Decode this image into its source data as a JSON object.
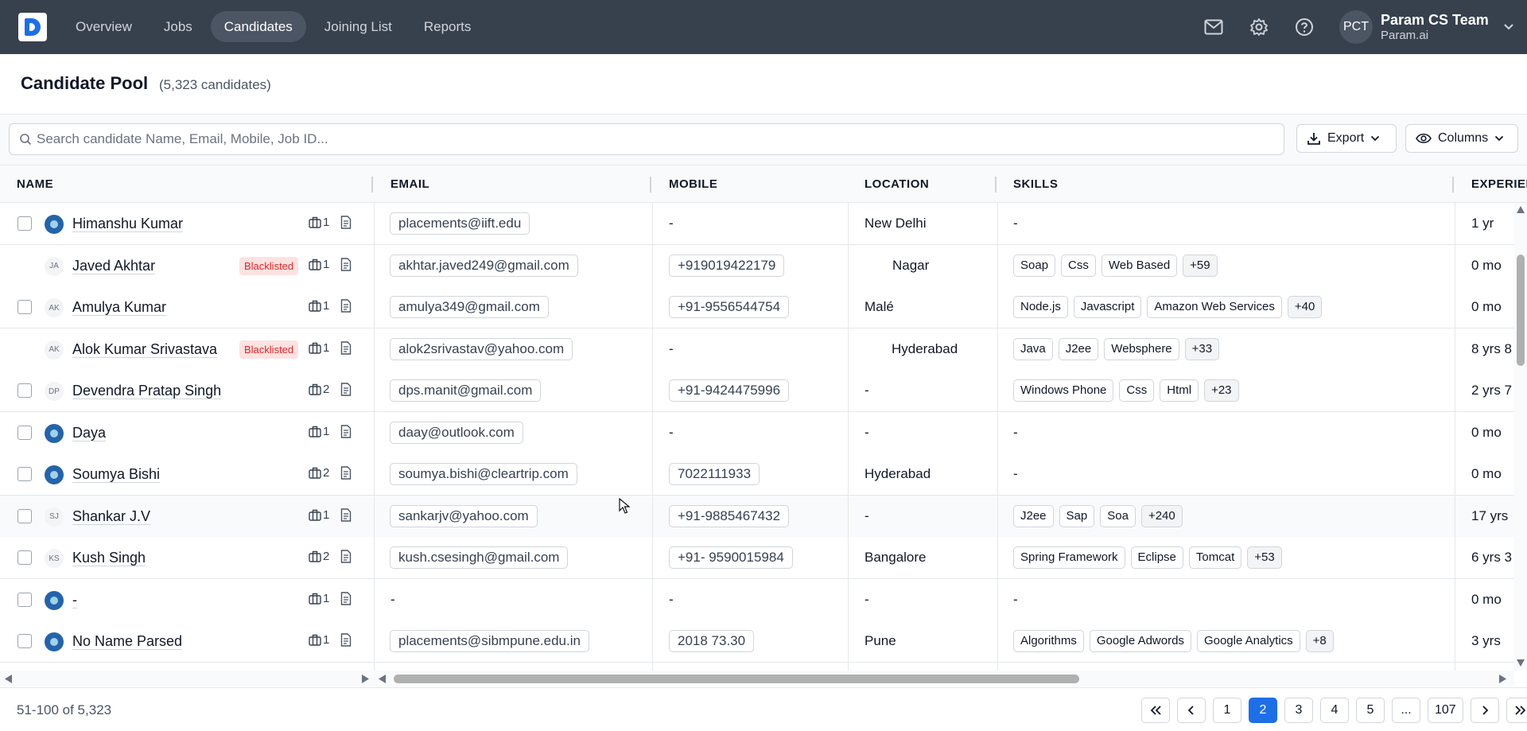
{
  "nav": {
    "links": [
      "Overview",
      "Jobs",
      "Candidates",
      "Joining List",
      "Reports"
    ],
    "active_index": 2,
    "user": {
      "initials": "PCT",
      "name": "Param CS Team",
      "org": "Param.ai"
    }
  },
  "page": {
    "title": "Candidate Pool",
    "count": "(5,323 candidates)"
  },
  "toolbar": {
    "search_placeholder": "Search candidate Name, Email, Mobile, Job ID...",
    "export_label": "Export",
    "columns_label": "Columns"
  },
  "table": {
    "headers": [
      "NAME",
      "EMAIL",
      "MOBILE",
      "LOCATION",
      "SKILLS",
      "EXPERIEN"
    ],
    "rows": [
      {
        "name": "Himanshu Kumar",
        "avatar": "photo",
        "initials": "",
        "blacklisted": false,
        "jobs": "1",
        "email": "placements@iift.edu",
        "mobile": "-",
        "location": "New Delhi",
        "skills": [],
        "experience": "1 yr"
      },
      {
        "name": "Javed Akhtar",
        "avatar": "initials",
        "initials": "JA",
        "blacklisted": true,
        "jobs": "1",
        "email": "akhtar.javed249@gmail.com",
        "mobile": "+919019422179",
        "location": "Nagar",
        "skills": [
          "Soap",
          "Css",
          "Web Based",
          "+59"
        ],
        "experience": "0 mo"
      },
      {
        "name": "Amulya Kumar",
        "avatar": "initials",
        "initials": "AK",
        "blacklisted": false,
        "jobs": "1",
        "email": "amulya349@gmail.com",
        "mobile": "+91-9556544754",
        "location": "Malé",
        "skills": [
          "Node.js",
          "Javascript",
          "Amazon Web Services",
          "+40"
        ],
        "experience": "0 mo"
      },
      {
        "name": "Alok Kumar Srivastava",
        "avatar": "initials",
        "initials": "AK",
        "blacklisted": true,
        "jobs": "1",
        "email": "alok2srivastav@yahoo.com",
        "mobile": "-",
        "location": "Hyderabad",
        "skills": [
          "Java",
          "J2ee",
          "Websphere",
          "+33"
        ],
        "experience": "8 yrs 8"
      },
      {
        "name": "Devendra Pratap Singh",
        "avatar": "initials",
        "initials": "DP",
        "blacklisted": false,
        "jobs": "2",
        "email": "dps.manit@gmail.com",
        "mobile": "+91-9424475996",
        "location": "-",
        "skills": [
          "Windows Phone",
          "Css",
          "Html",
          "+23"
        ],
        "experience": "2 yrs 7"
      },
      {
        "name": "Daya",
        "avatar": "photo",
        "initials": "",
        "blacklisted": false,
        "jobs": "1",
        "email": "daay@outlook.com",
        "mobile": "-",
        "location": "-",
        "skills": [],
        "experience": "0 mo"
      },
      {
        "name": "Soumya Bishi",
        "avatar": "photo",
        "initials": "",
        "blacklisted": false,
        "jobs": "2",
        "email": "soumya.bishi@cleartrip.com",
        "mobile": "7022111933",
        "location": "Hyderabad",
        "skills": [],
        "experience": "0 mo"
      },
      {
        "name": "Shankar J.V",
        "avatar": "initials",
        "initials": "SJ",
        "blacklisted": false,
        "jobs": "1",
        "email": "sankarjv@yahoo.com",
        "mobile": "+91-9885467432",
        "location": "-",
        "skills": [
          "J2ee",
          "Sap",
          "Soa",
          "+240"
        ],
        "experience": "17 yrs"
      },
      {
        "name": "Kush Singh",
        "avatar": "initials",
        "initials": "KS",
        "blacklisted": false,
        "jobs": "2",
        "email": "kush.csesingh@gmail.com",
        "mobile": "+91- 9590015984",
        "location": "Bangalore",
        "skills": [
          "Spring Framework",
          "Eclipse",
          "Tomcat",
          "+53"
        ],
        "experience": "6 yrs 3"
      },
      {
        "name": "-",
        "avatar": "photo",
        "initials": "",
        "blacklisted": false,
        "jobs": "1",
        "email": "-",
        "mobile": "-",
        "location": "-",
        "skills": [],
        "experience": "0 mo"
      },
      {
        "name": "No Name Parsed",
        "avatar": "photo",
        "initials": "",
        "blacklisted": false,
        "jobs": "1",
        "email": "placements@sibmpune.edu.in",
        "mobile": "2018 73.30",
        "location": "Pune",
        "skills": [
          "Algorithms",
          "Google Adwords",
          "Google Analytics",
          "+8"
        ],
        "experience": "3 yrs"
      }
    ],
    "blacklisted_label": "Blacklisted",
    "empty_value": "-"
  },
  "footer": {
    "range": "51-100 of 5,323",
    "pages": [
      "1",
      "2",
      "3",
      "4",
      "5",
      "...",
      "107"
    ],
    "active_page": "2"
  },
  "colors": {
    "nav_bg": "#37404d",
    "accent": "#1e6fe6",
    "blacklisted": "#dc2626"
  }
}
